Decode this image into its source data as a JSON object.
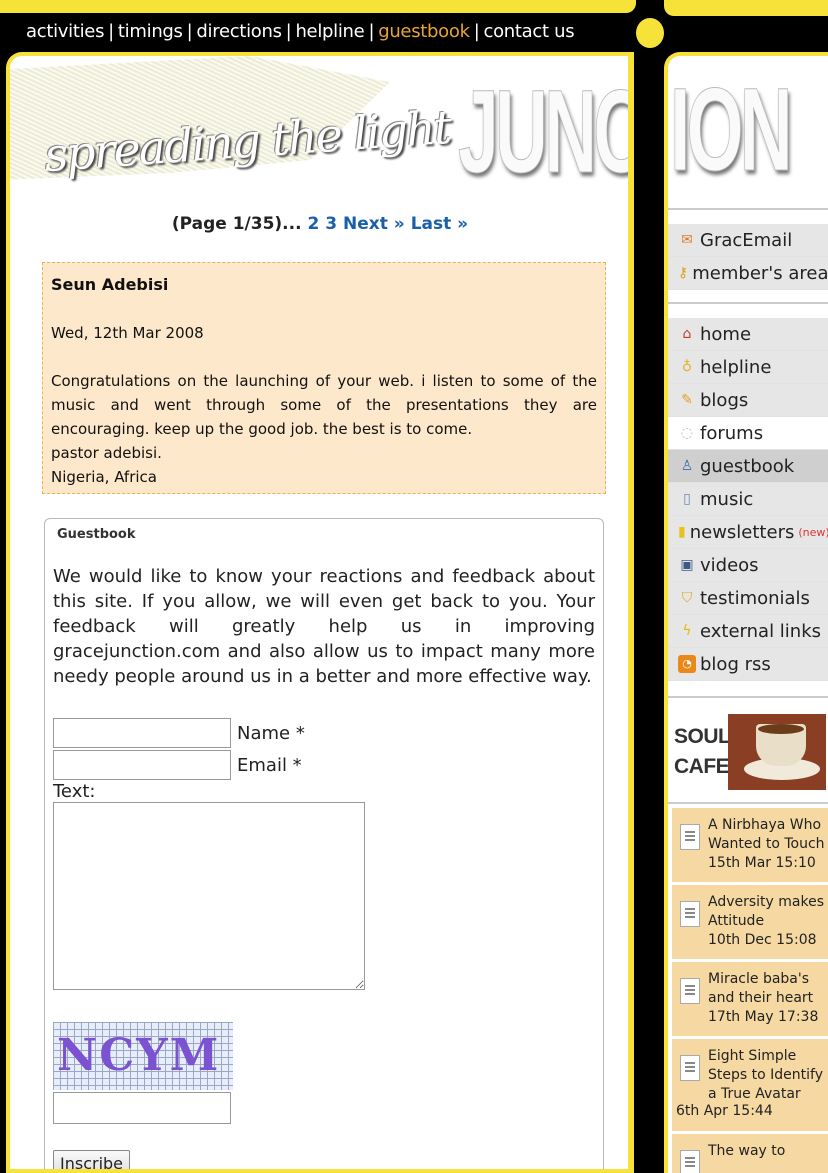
{
  "topnav": {
    "items": [
      {
        "label": "activities"
      },
      {
        "label": "timings"
      },
      {
        "label": "directions"
      },
      {
        "label": "helpline"
      },
      {
        "label": "guestbook"
      },
      {
        "label": "contact us"
      }
    ],
    "separator": "|"
  },
  "header": {
    "tagline": "spreading the light",
    "logo_left": "JUNC",
    "logo_right": "ION"
  },
  "pager": {
    "status": "(Page 1/35)...",
    "page2": "2",
    "page3": "3",
    "next": "Next »",
    "last": "Last »"
  },
  "entry": {
    "author": "Seun Adebisi",
    "date": "Wed, 12th Mar 2008",
    "message": "Congratulations on the launching of your web. i listen to some of the music and went through some of the presentations they are encouraging. keep up the good job. the best is to come.",
    "signoff": "pastor adebisi.",
    "location": "Nigeria, Africa"
  },
  "guestbook": {
    "title": "Guestbook",
    "intro": "We would like to know your reactions and feedback about this site. If you allow, we will even get back to you. Your feedback will greatly help us in improving gracejunction.com and also allow us to impact many more needy people around us in a better and more effective way.",
    "name_label": "Name *",
    "email_label": "Email *",
    "text_label": "Text:",
    "captcha_text": "NCYM",
    "submit_label": "Inscribe"
  },
  "sidebar": {
    "top_links": [
      {
        "label": "GracEmail",
        "icon": "envelope-icon"
      },
      {
        "label": "member's area",
        "icon": "key-icon"
      }
    ],
    "menu": [
      {
        "label": "home",
        "icon": "home-icon"
      },
      {
        "label": "helpline",
        "icon": "bulb-icon"
      },
      {
        "label": "blogs",
        "icon": "pencil-icon"
      },
      {
        "label": "forums",
        "icon": "forum-icon"
      },
      {
        "label": "guestbook",
        "icon": "user-icon"
      },
      {
        "label": "music",
        "icon": "music-icon"
      },
      {
        "label": "newsletters",
        "icon": "newsletter-icon",
        "badge": "(new)"
      },
      {
        "label": "videos",
        "icon": "tv-icon"
      },
      {
        "label": "testimonials",
        "icon": "shield-icon"
      },
      {
        "label": "external links",
        "icon": "lightning-icon"
      },
      {
        "label": "blog rss",
        "icon": "rss-icon"
      }
    ],
    "cafe": {
      "line1": "SOUL",
      "line2": "CAFE"
    },
    "news": [
      {
        "title": "A Nirbhaya Who Wanted to Touch",
        "date": "15th Mar 15:10"
      },
      {
        "title": "Adversity makes Attitude",
        "date": "10th Dec 15:08"
      },
      {
        "title": "Miracle baba's and their heart",
        "date": "17th May 17:38"
      },
      {
        "title": "Eight Simple Steps to Identify a True Avatar",
        "date": "6th Apr 15:44"
      },
      {
        "title": "The way to",
        "date": ""
      }
    ]
  },
  "colors": {
    "accent_yellow": "#f7e23a",
    "active_nav": "#e8a534",
    "entry_bg": "#fee8cb",
    "news_bg": "#f6d9a2"
  }
}
